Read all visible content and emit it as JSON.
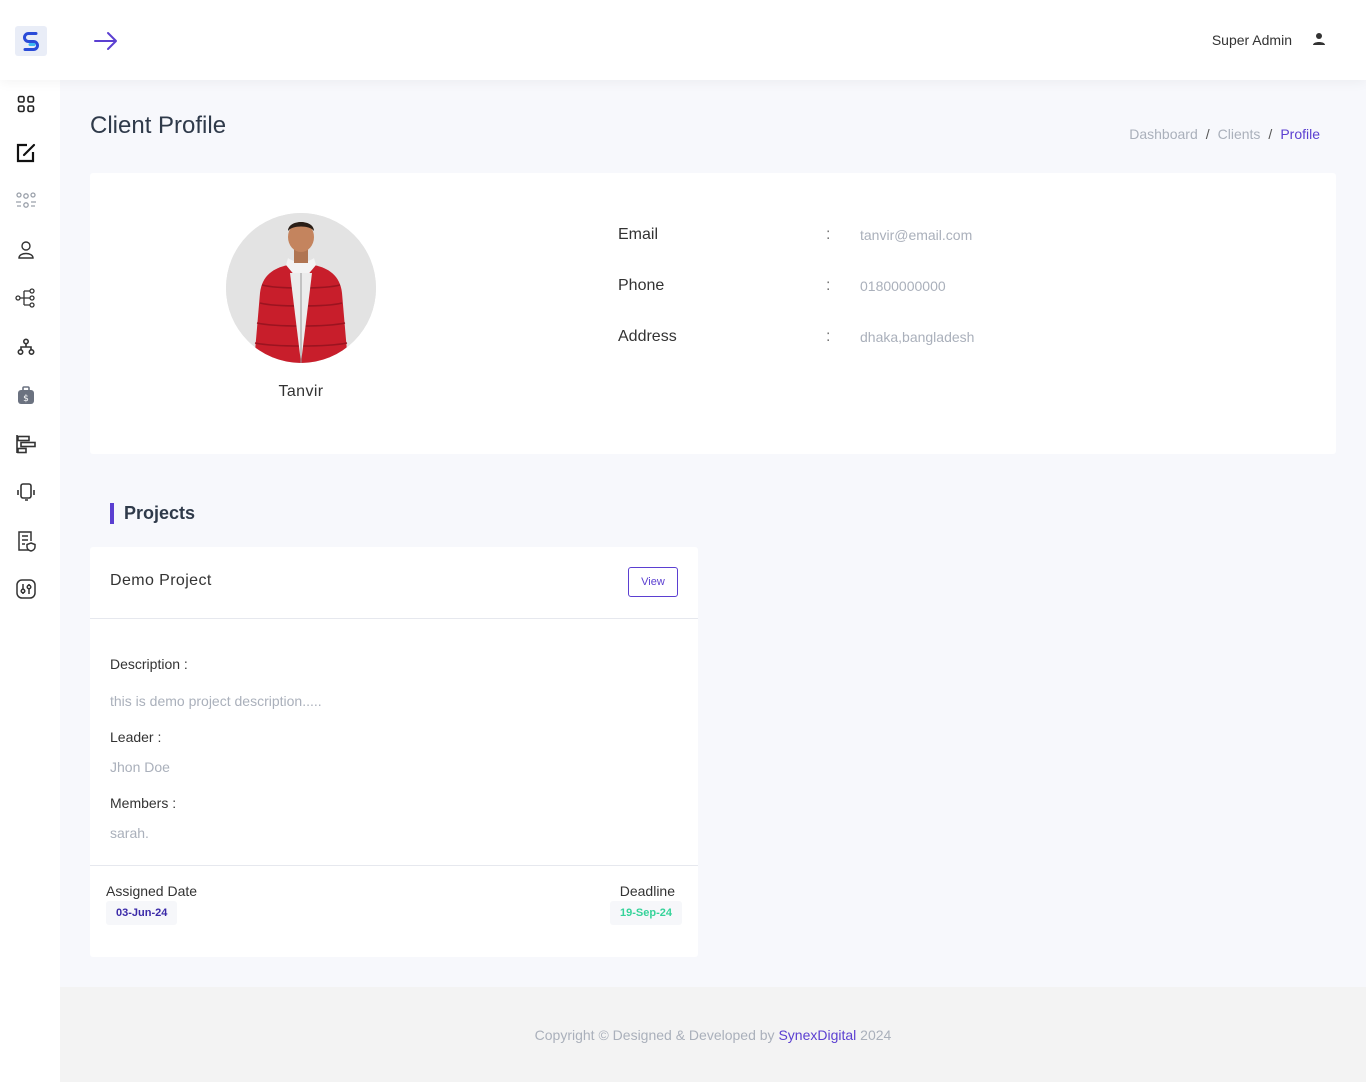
{
  "header": {
    "user_name": "Super Admin"
  },
  "icons": {
    "logo": "logo-icon",
    "toggle": "arrow-right-icon",
    "user": "user-icon"
  },
  "sidebar": {
    "items": [
      {
        "icon": "dashboard-grid-icon"
      },
      {
        "icon": "edit-icon"
      },
      {
        "icon": "clients-group-icon"
      },
      {
        "icon": "user-icon"
      },
      {
        "icon": "projects-tree-icon"
      },
      {
        "icon": "hierarchy-icon"
      },
      {
        "icon": "money-bag-icon"
      },
      {
        "icon": "timeline-icon"
      },
      {
        "icon": "headset-icon"
      },
      {
        "icon": "report-shield-icon"
      },
      {
        "icon": "settings-panel-icon"
      }
    ]
  },
  "page": {
    "title": "Client Profile",
    "breadcrumb": [
      "Dashboard",
      "Clients",
      "Profile"
    ]
  },
  "profile": {
    "name": "Tanvir",
    "fields": [
      {
        "label": "Email",
        "colon": ":",
        "value": "tanvir@email.com"
      },
      {
        "label": "Phone",
        "colon": ":",
        "value": "01800000000"
      },
      {
        "label": "Address",
        "colon": ":",
        "value": "dhaka,bangladesh"
      }
    ]
  },
  "projects": {
    "section_title": "Projects",
    "items": [
      {
        "name": "Demo Project",
        "view_label": "View",
        "description_label": "Description :",
        "description": "this is demo project description.....",
        "leader_label": "Leader :",
        "leader": "Jhon Doe",
        "members_label": "Members :",
        "members": "sarah.",
        "assigned_label": "Assigned Date",
        "assigned_date": "03-Jun-24",
        "deadline_label": "Deadline",
        "deadline": "19-Sep-24"
      }
    ]
  },
  "colors": {
    "accent": "#5b3fd1",
    "deadline": "#36d39a",
    "muted": "#aab0bb"
  },
  "footer": {
    "prefix": "Copyright © Designed & Developed by",
    "brand": "SynexDigital",
    "year": "2024"
  }
}
